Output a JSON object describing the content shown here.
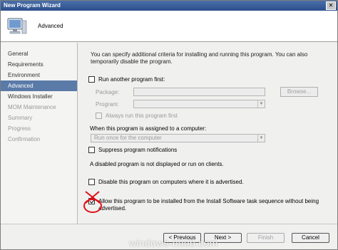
{
  "window": {
    "title": "New Program Wizard"
  },
  "header": {
    "title": "Advanced"
  },
  "sidebar": {
    "items": [
      {
        "label": "General",
        "state": "normal"
      },
      {
        "label": "Requirements",
        "state": "normal"
      },
      {
        "label": "Environment",
        "state": "normal"
      },
      {
        "label": "Advanced",
        "state": "active"
      },
      {
        "label": "Windows Installer",
        "state": "normal"
      },
      {
        "label": "MOM Maintenance",
        "state": "disabled"
      },
      {
        "label": "Summary",
        "state": "disabled"
      },
      {
        "label": "Progress",
        "state": "disabled"
      },
      {
        "label": "Confirmation",
        "state": "disabled"
      }
    ]
  },
  "main": {
    "description": "You can specify additional criteria for installing and running this program. You can also temporarily disable the program.",
    "run_another": {
      "label": "Run another program first:",
      "checked": false
    },
    "package_label": "Package:",
    "browse_label": "Browse...",
    "program_label": "Program:",
    "always_run_label": "Always run this program first",
    "assigned_label": "When this program is assigned to a computer:",
    "assigned_value": "Run once for the computer",
    "suppress": {
      "label": "Suppress program notifications",
      "checked": false
    },
    "disabled_note": "A disabled program is not displayed or run on clients.",
    "disable": {
      "label": "Disable this program on computers where it is advertised.",
      "checked": false
    },
    "allow": {
      "label_line1": "Allow this program to be installed from the Install Software task sequence without being",
      "label_line2": "advertised.",
      "checked": true
    }
  },
  "footer": {
    "previous": "< Previous",
    "next": "Next >",
    "finish": "Finish",
    "cancel": "Cancel"
  },
  "watermark": "windows-noob.com",
  "colors": {
    "title_bar": "#2b4f8c",
    "active_item": "#5a7aa8",
    "annotation": "#e0101a"
  }
}
